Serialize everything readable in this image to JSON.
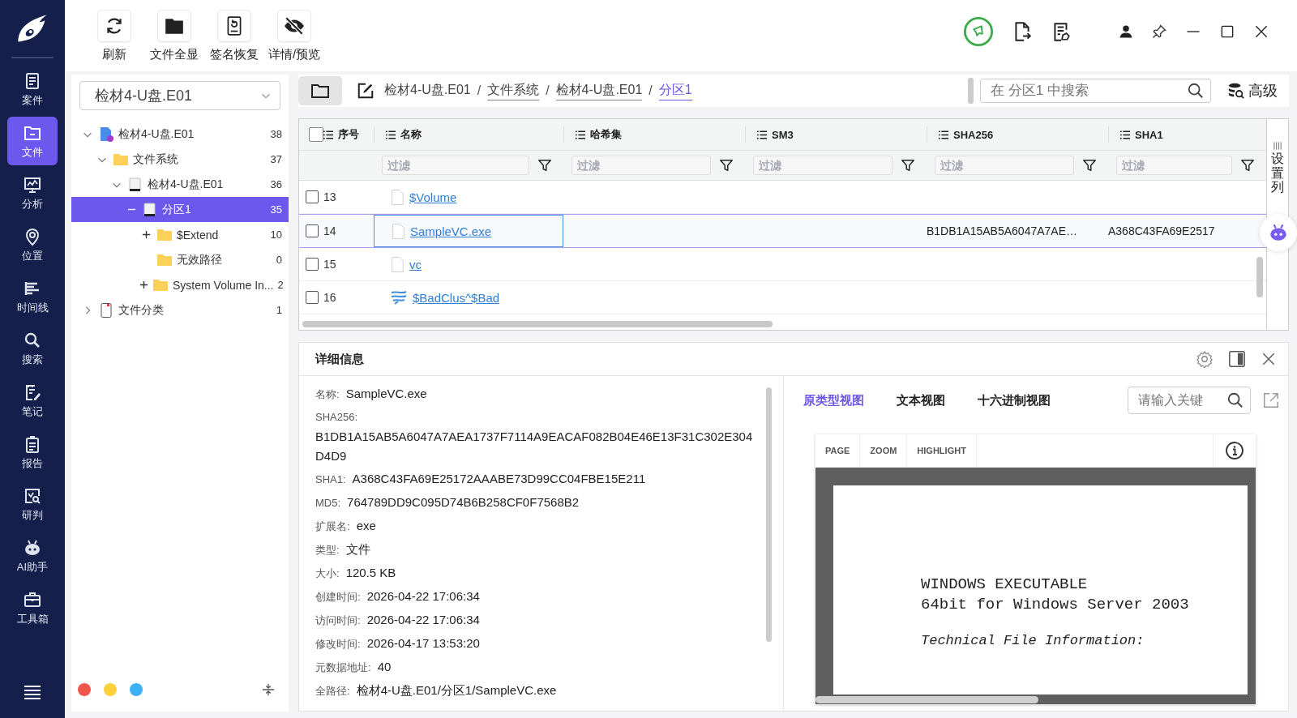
{
  "nav": {
    "items": [
      {
        "label": "案件",
        "selected": false
      },
      {
        "label": "文件",
        "selected": true
      },
      {
        "label": "分析",
        "selected": false
      },
      {
        "label": "位置",
        "selected": false
      },
      {
        "label": "时间线",
        "selected": false
      },
      {
        "label": "搜索",
        "selected": false
      },
      {
        "label": "笔记",
        "selected": false
      },
      {
        "label": "报告",
        "selected": false
      },
      {
        "label": "研判",
        "selected": false
      },
      {
        "label": "AI助手",
        "selected": false
      },
      {
        "label": "工具箱",
        "selected": false
      }
    ]
  },
  "toolbar": {
    "buttons": [
      {
        "label": "刷新"
      },
      {
        "label": "文件全显"
      },
      {
        "label": "签名恢复"
      },
      {
        "label": "详情/预览"
      }
    ]
  },
  "file_tree": {
    "source_select": "检材4-U盘.E01",
    "nodes": [
      {
        "label": "检材4-U盘.E01",
        "count": "38",
        "kind": "image",
        "expanded": true,
        "selected": false,
        "children": [
          {
            "label": "文件系统",
            "count": "37",
            "kind": "folder",
            "expanded": true,
            "selected": false,
            "children": [
              {
                "label": "检材4-U盘.E01",
                "count": "36",
                "kind": "disk",
                "expanded": true,
                "selected": false,
                "children": [
                  {
                    "label": "分区1",
                    "count": "35",
                    "kind": "disk",
                    "expanded": true,
                    "selected": true,
                    "children": [
                      {
                        "label": "$Extend",
                        "count": "10",
                        "kind": "folder",
                        "expanded": false,
                        "selected": false
                      },
                      {
                        "label": "无效路径",
                        "count": "0",
                        "kind": "folder",
                        "selected": false
                      },
                      {
                        "label": "System Volume In...",
                        "count": "2",
                        "kind": "folder",
                        "expanded": false,
                        "selected": false
                      }
                    ]
                  }
                ]
              }
            ]
          }
        ]
      },
      {
        "label": "文件分类",
        "count": "1",
        "kind": "category",
        "expanded": false,
        "selected": false
      }
    ]
  },
  "color_dots": [
    {
      "color": "#f2574c"
    },
    {
      "color": "#fcd03a"
    },
    {
      "color": "#3db1f6"
    }
  ],
  "breadcrumb": [
    {
      "label": "检材4-U盘.E01",
      "selected": false
    },
    {
      "separator": "/",
      "label": "文件系统",
      "selected": false
    },
    {
      "separator": "/",
      "label": "检材4-U盘.E01",
      "selected": false
    },
    {
      "separator": "/",
      "label": "分区1",
      "selected": true
    }
  ],
  "search": {
    "placeholder": "在 分区1 中搜索"
  },
  "advanced_button": "高级",
  "table": {
    "header_checked": false,
    "columns": [
      {
        "label": "序号"
      },
      {
        "label": "名称"
      },
      {
        "label": "哈希集"
      },
      {
        "label": "SM3"
      },
      {
        "label": "SHA256"
      },
      {
        "label": "SHA1"
      }
    ],
    "filters": [
      {
        "placeholder": "过滤"
      },
      {
        "placeholder": "过滤"
      },
      {
        "placeholder": "过滤"
      },
      {
        "placeholder": "过滤"
      },
      {
        "placeholder": "过滤"
      }
    ],
    "rows": [
      {
        "index": "13",
        "name": "$Volume",
        "kind": "file",
        "checked": false,
        "selected": false
      },
      {
        "index": "14",
        "name": "SampleVC.exe",
        "kind": "file",
        "checked": false,
        "selected": true,
        "sha256": "B1DB1A15AB5A6047A7AE…",
        "sha1": "A368C43FA69E2517"
      },
      {
        "index": "15",
        "name": "vc",
        "kind": "file",
        "checked": false,
        "selected": false
      },
      {
        "index": "16",
        "name": "$BadClus^$Bad",
        "kind": "stream",
        "checked": false,
        "selected": false
      }
    ]
  },
  "column_settings": "设置列",
  "details": {
    "title": "详细信息",
    "fields": [
      {
        "label": "名称:",
        "value": "SampleVC.exe",
        "kind": "inline"
      },
      {
        "label": "SHA256:",
        "value": "B1DB1A15AB5A6047A7AEA1737F7114A9EACAF082B04E46E13F31C302E304D4D9",
        "kind": "block"
      },
      {
        "label": "SHA1:",
        "value": "A368C43FA69E25172AAABE73D99CC04FBE15E211",
        "kind": "inline"
      },
      {
        "label": "MD5:",
        "value": "764789DD9C095D74B6B258CF0F7568B2",
        "kind": "inline"
      },
      {
        "label": "扩展名:",
        "value": "exe",
        "kind": "inline"
      },
      {
        "label": "类型:",
        "value": "文件",
        "kind": "inline"
      },
      {
        "label": "大小:",
        "value": "120.5 KB",
        "kind": "inline"
      },
      {
        "label": "创建时间:",
        "value": "2026-04-22 17:06:34",
        "kind": "inline"
      },
      {
        "label": "访问时间:",
        "value": "2026-04-22 17:06:34",
        "kind": "inline"
      },
      {
        "label": "修改时间:",
        "value": "2026-04-17 13:53:20",
        "kind": "inline"
      },
      {
        "label": "元数据地址:",
        "value": "40",
        "kind": "inline"
      },
      {
        "label": "全路径:",
        "value": "检材4-U盘.E01/分区1/SampleVC.exe",
        "kind": "inline"
      }
    ]
  },
  "preview": {
    "tabs": [
      {
        "label": "原类型视图",
        "selected": true
      },
      {
        "label": "文本视图",
        "selected": false
      },
      {
        "label": "十六进制视图",
        "selected": false
      }
    ],
    "search_placeholder": "请输入关键",
    "viewer_tools": [
      {
        "label": "PAGE"
      },
      {
        "label": "ZOOM"
      },
      {
        "label": "HIGHLIGHT"
      }
    ],
    "document_lines": [
      {
        "text": "WINDOWS EXECUTABLE",
        "kind": "heading"
      },
      {
        "text": "64bit for Windows Server 2003",
        "kind": "heading"
      },
      {
        "text": "Technical File Information:",
        "kind": "subheading"
      }
    ]
  }
}
